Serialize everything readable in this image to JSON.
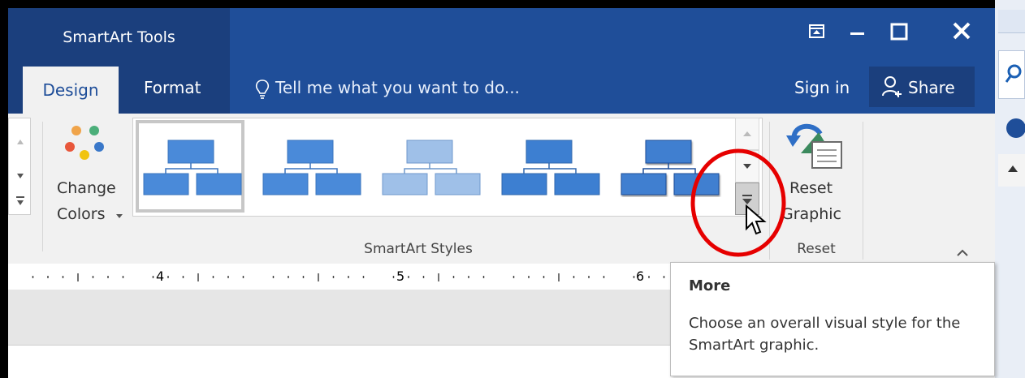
{
  "window": {
    "contextual_tab_group": "SmartArt Tools",
    "controls": [
      "restore-ribbon-icon",
      "minimize-icon",
      "maximize-icon",
      "close-icon"
    ]
  },
  "tabs": [
    {
      "label": "Design",
      "active": true
    },
    {
      "label": "Format",
      "active": false
    }
  ],
  "tell_me": {
    "placeholder": "Tell me what you want to do..."
  },
  "account": {
    "sign_in": "Sign in",
    "share": "Share"
  },
  "ribbon": {
    "change_colors": {
      "line1": "Change",
      "line2": "Colors"
    },
    "smartart_styles_group": "SmartArt Styles",
    "reset": {
      "line1": "Reset",
      "line2": "Graphic",
      "group": "Reset"
    }
  },
  "ruler": {
    "numbers": [
      "4",
      "5",
      "6"
    ]
  },
  "tooltip": {
    "title": "More",
    "description": "Choose an overall visual style for the SmartArt graphic."
  },
  "colors": {
    "title_bar": "#1f4e99",
    "contextual_group": "#1b3f7d",
    "ribbon": "#f1f1f1",
    "shape_blue": "#4a8ad9",
    "highlight_circle": "#e60000"
  }
}
